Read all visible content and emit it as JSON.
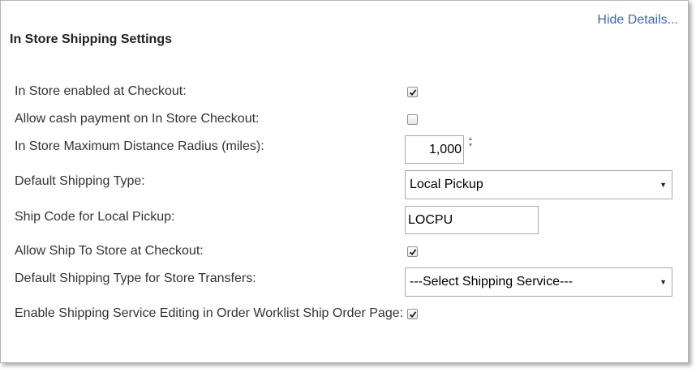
{
  "header": {
    "hide_details": "Hide Details...",
    "title": "In Store Shipping Settings"
  },
  "rows": {
    "in_store_enabled": {
      "label": "In Store enabled at Checkout:",
      "checked": true
    },
    "allow_cash": {
      "label": "Allow cash payment on In Store Checkout:",
      "checked": false
    },
    "max_radius": {
      "label": "In Store Maximum Distance Radius (miles):",
      "value": "1,000"
    },
    "default_shipping_type": {
      "label": "Default Shipping Type:",
      "selected": "Local Pickup"
    },
    "ship_code": {
      "label": "Ship Code for Local Pickup:",
      "value": "LOCPU"
    },
    "allow_ship_to_store": {
      "label": "Allow Ship To Store at Checkout:",
      "checked": true
    },
    "store_transfers_type": {
      "label": "Default Shipping Type for Store Transfers:",
      "selected": "---Select Shipping Service---"
    },
    "enable_editing": {
      "label": "Enable Shipping Service Editing in Order Worklist Ship Order Page:",
      "checked": true
    }
  },
  "colors": {
    "link": "#3b6aa8",
    "border": "#a9a9a9"
  }
}
